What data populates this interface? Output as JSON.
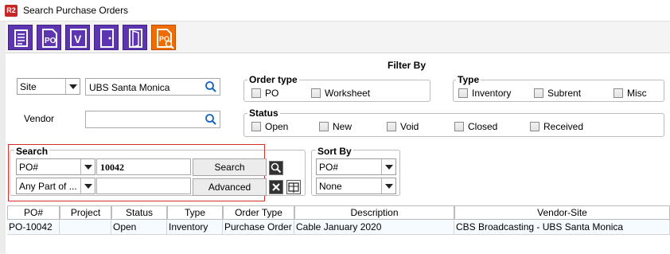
{
  "window": {
    "app_icon_text": "R2",
    "title": "Search Purchase Orders"
  },
  "toolbar": {
    "buttons": [
      {
        "icon": "report-icon"
      },
      {
        "icon": "po-document-icon",
        "text": "PO"
      },
      {
        "icon": "vendor-icon",
        "text": "V"
      },
      {
        "icon": "door-exit-icon"
      },
      {
        "icon": "door-open-icon"
      },
      {
        "icon": "po-search-icon",
        "text": "PO"
      }
    ]
  },
  "filter": {
    "heading": "Filter By",
    "site_combo": "Site",
    "site_value": "UBS Santa Monica",
    "vendor_label": "Vendor",
    "vendor_value": "",
    "order_type": {
      "title": "Order type",
      "options": [
        "PO",
        "Worksheet"
      ]
    },
    "type": {
      "title": "Type",
      "options": [
        "Inventory",
        "Subrent",
        "Misc"
      ]
    },
    "status": {
      "title": "Status",
      "options": [
        "Open",
        "New",
        "Void",
        "Closed",
        "Received"
      ]
    }
  },
  "search": {
    "title": "Search",
    "field_combo": "PO#",
    "value": "10042",
    "match_combo": "Any Part of ...",
    "value2": "",
    "search_label": "Search",
    "advanced_label": "Advanced"
  },
  "sort": {
    "title": "Sort By",
    "first": "PO#",
    "second": "None"
  },
  "table": {
    "columns": [
      "PO#",
      "Project",
      "Status",
      "Type",
      "Order Type",
      "Description",
      "Vendor-Site"
    ],
    "rows": [
      [
        "PO-10042",
        "",
        "Open",
        "Inventory",
        "Purchase Order",
        "Cable January 2020",
        "CBS Broadcasting - UBS Santa Monica"
      ]
    ]
  },
  "colors": {
    "purple": "#5e35b1",
    "orange": "#ef6c00",
    "highlight_red": "#d32f2f"
  }
}
